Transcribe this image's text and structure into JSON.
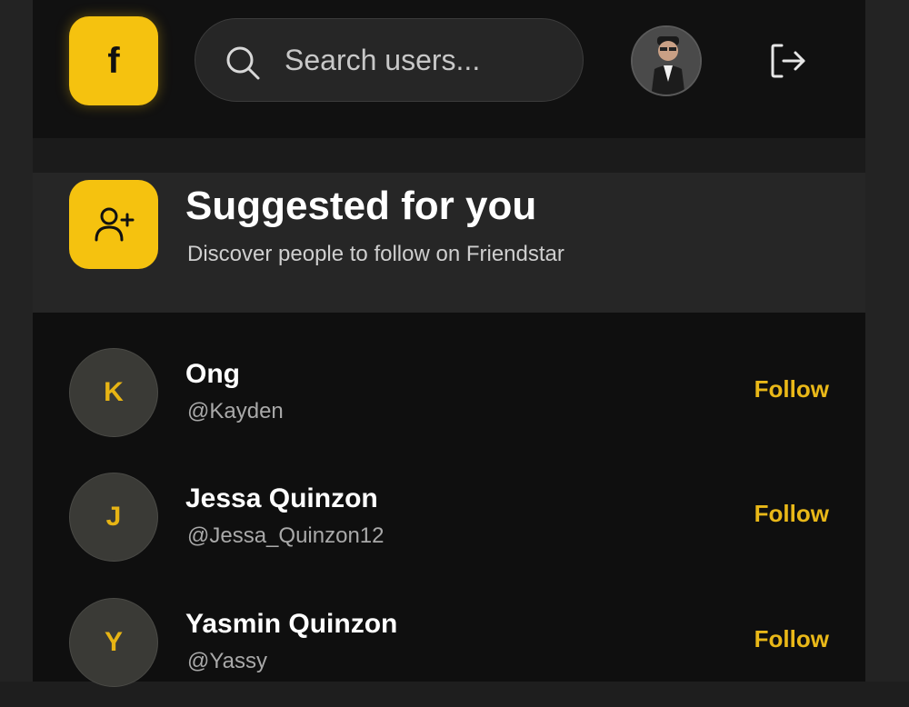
{
  "header": {
    "logo_letter": "f",
    "search_placeholder": "Search users...",
    "search_value": ""
  },
  "suggested": {
    "title": "Suggested for you",
    "subtitle": "Discover people to follow on Friendstar"
  },
  "users": [
    {
      "initial": "K",
      "name": "Ong",
      "handle": "@Kayden",
      "action": "Follow"
    },
    {
      "initial": "J",
      "name": "Jessa Quinzon",
      "handle": "@Jessa_Quinzon12",
      "action": "Follow"
    },
    {
      "initial": "Y",
      "name": "Yasmin Quinzon",
      "handle": "@Yassy",
      "action": "Follow"
    }
  ],
  "colors": {
    "accent": "#f5c20f",
    "background": "#0f0f0f",
    "banner": "#262626"
  },
  "icons": {
    "search": "search-icon",
    "logout": "logout-icon",
    "add_user": "add-user-icon"
  }
}
